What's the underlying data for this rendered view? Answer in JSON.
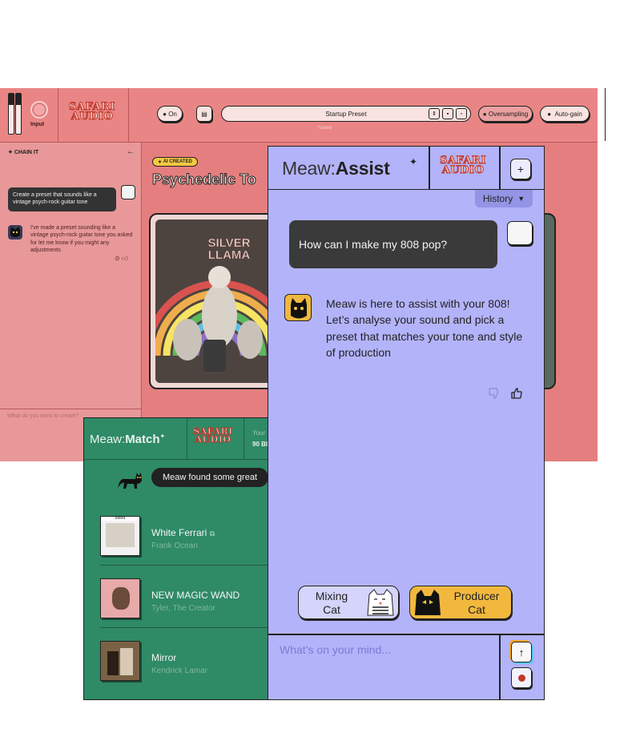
{
  "plugin": {
    "input_label": "Input",
    "logo": "SAFARI AUDIO",
    "on_label": "On",
    "preset_name": "Startup Preset",
    "preset_status": "*saved",
    "oversampling_label": "Oversampling",
    "autogain_label": "Auto-gain",
    "chain": {
      "title": "CHAIN IT",
      "user_message": "Create a preset that sounds like a vintage psych-rock guitar tone",
      "reply": "I've made a preset sounding like a vintage psych-rock guitar tone you asked for let me know if you might any adjustments",
      "input_placeholder": "What do you want to create?"
    },
    "ai_badge": "AI CREATED",
    "preset_title": "Psychedelic To",
    "artwork_text": "SILVER LLAMA"
  },
  "match": {
    "title_prefix": "Meaw:",
    "title_bold": "Match",
    "logo": "SAFARI AUDIO",
    "side_text_1": "Your",
    "side_text_2": "90 BI",
    "bubble": "Meaw found some great",
    "tracks": [
      {
        "title": "White Ferrari",
        "artist": "Frank Ocean",
        "art_label": "blond"
      },
      {
        "title": "NEW MAGIC WAND",
        "artist": "Tyler, The Creator"
      },
      {
        "title": "Mirror",
        "artist": "Kendrick Lamar"
      }
    ]
  },
  "assist": {
    "title_prefix": "Meaw:",
    "title_bold": "Assist",
    "logo": "SAFARI AUDIO",
    "plus_label": "+",
    "history_label": "History",
    "user_message": "How can I make my 808 pop?",
    "reply": "Meaw is here to assist with your 808! Let’s analyse your sound and pick a preset that matches your tone and style of production",
    "mixing_cat": "Mixing Cat",
    "producer_cat": "Producer Cat",
    "input_placeholder": "What’s on your mind...",
    "send_label": "↑"
  },
  "colors": {
    "plugin_bg": "#e57f7f",
    "match_bg": "#2f8a66",
    "assist_bg": "#b3b3fa",
    "producer_btn": "#f2b83e",
    "ai_badge": "#f6c842"
  }
}
